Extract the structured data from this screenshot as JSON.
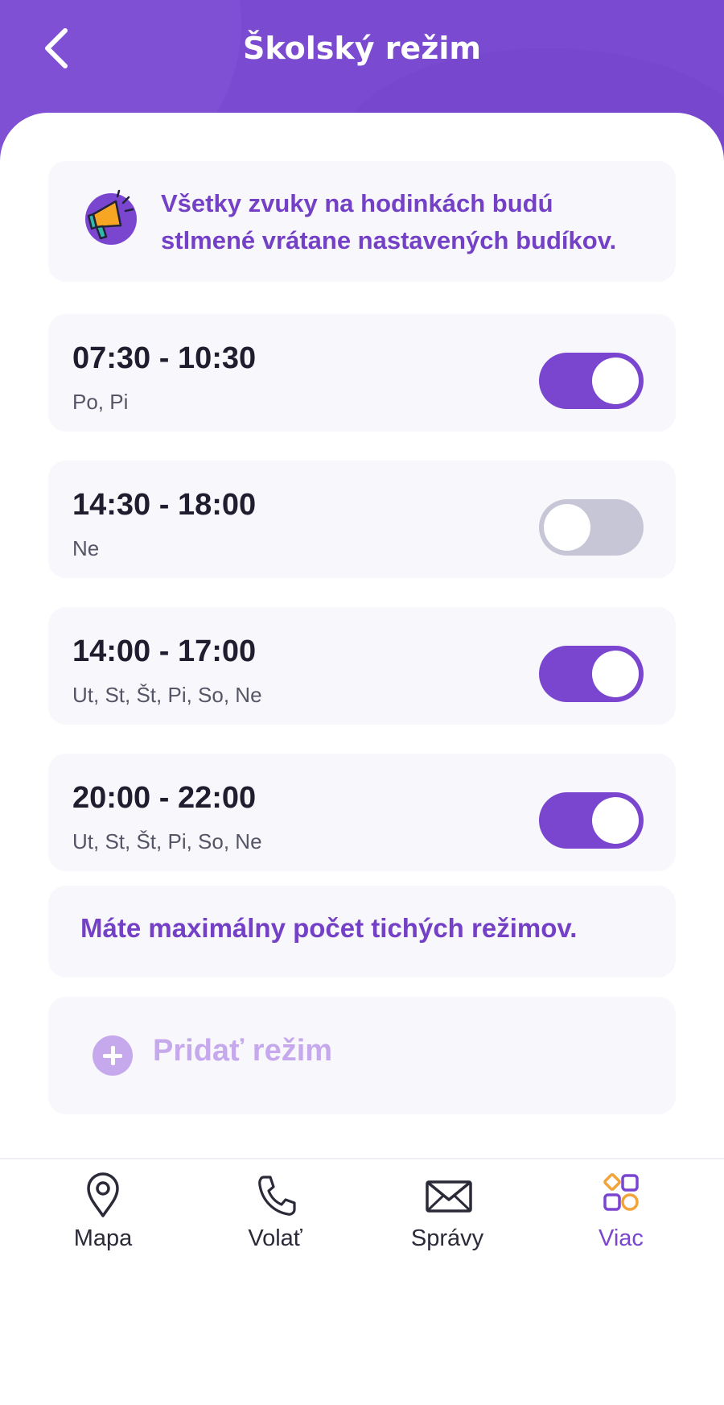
{
  "header": {
    "title": "Školský režim",
    "back_icon": "chevron-left-icon"
  },
  "info": {
    "icon": "megaphone-icon",
    "text_line1": "Všetky zvuky na hodinkách budú",
    "text_line2": "stlmené vrátane nastavených budíkov."
  },
  "schedules": [
    {
      "time": "07:30 - 10:30",
      "days": "Po, Pi",
      "enabled": true
    },
    {
      "time": "14:30 - 18:00",
      "days": "Ne",
      "enabled": false
    },
    {
      "time": "14:00 - 17:00",
      "days": "Ut, St, Št, Pi, So, Ne",
      "enabled": true
    },
    {
      "time": "20:00 - 22:00",
      "days": "Ut, St, Št, Pi, So, Ne",
      "enabled": true
    }
  ],
  "limit_notice": "Máte maximálny počet tichých režimov.",
  "add_button": {
    "label": "Pridať režim",
    "icon": "plus-circle-icon",
    "disabled": true
  },
  "tabbar": {
    "items": [
      {
        "label": "Mapa",
        "icon": "map-pin-icon",
        "active": false
      },
      {
        "label": "Volať",
        "icon": "phone-icon",
        "active": false
      },
      {
        "label": "Správy",
        "icon": "envelope-icon",
        "active": false
      },
      {
        "label": "Viac",
        "icon": "apps-grid-icon",
        "active": true
      }
    ]
  },
  "colors": {
    "accent": "#7a45cf",
    "header_bg": "#7a4ad0",
    "toggle_off": "#c6c6d6",
    "card_bg": "#f7f7fc"
  }
}
